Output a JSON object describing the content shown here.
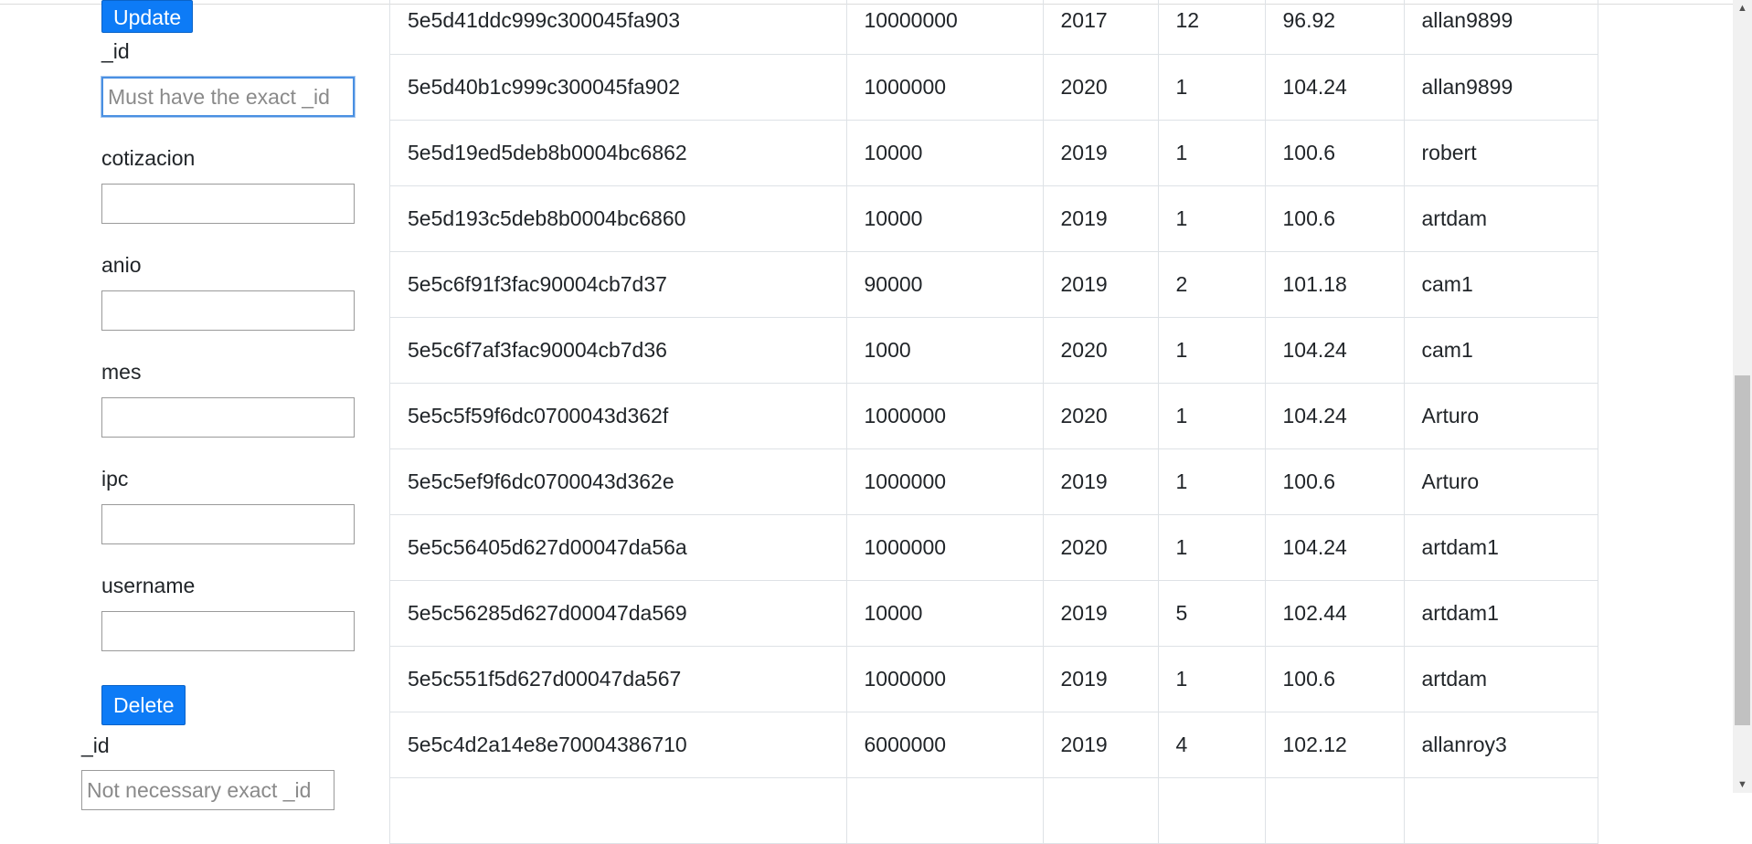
{
  "update_form": {
    "button_label": "Update",
    "fields": [
      {
        "label": "_id",
        "placeholder": "Must have the exact _id",
        "value": ""
      },
      {
        "label": "cotizacion",
        "placeholder": "",
        "value": ""
      },
      {
        "label": "anio",
        "placeholder": "",
        "value": ""
      },
      {
        "label": "mes",
        "placeholder": "",
        "value": ""
      },
      {
        "label": "ipc",
        "placeholder": "",
        "value": ""
      },
      {
        "label": "username",
        "placeholder": "",
        "value": ""
      }
    ]
  },
  "delete_form": {
    "button_label": "Delete",
    "fields": [
      {
        "label": "_id",
        "placeholder": "Not necessary exact _id",
        "value": ""
      }
    ]
  },
  "table": {
    "rows": [
      [
        "5e5d41ddc999c300045fa903",
        "10000000",
        "2017",
        "12",
        "96.92",
        "allan9899"
      ],
      [
        "5e5d40b1c999c300045fa902",
        "1000000",
        "2020",
        "1",
        "104.24",
        "allan9899"
      ],
      [
        "5e5d19ed5deb8b0004bc6862",
        "10000",
        "2019",
        "1",
        "100.6",
        "robert"
      ],
      [
        "5e5d193c5deb8b0004bc6860",
        "10000",
        "2019",
        "1",
        "100.6",
        "artdam"
      ],
      [
        "5e5c6f91f3fac90004cb7d37",
        "90000",
        "2019",
        "2",
        "101.18",
        "cam1"
      ],
      [
        "5e5c6f7af3fac90004cb7d36",
        "1000",
        "2020",
        "1",
        "104.24",
        "cam1"
      ],
      [
        "5e5c5f59f6dc0700043d362f",
        "1000000",
        "2020",
        "1",
        "104.24",
        "Arturo"
      ],
      [
        "5e5c5ef9f6dc0700043d362e",
        "1000000",
        "2019",
        "1",
        "100.6",
        "Arturo"
      ],
      [
        "5e5c56405d627d00047da56a",
        "1000000",
        "2020",
        "1",
        "104.24",
        "artdam1"
      ],
      [
        "5e5c56285d627d00047da569",
        "10000",
        "2019",
        "5",
        "102.44",
        "artdam1"
      ],
      [
        "5e5c551f5d627d00047da567",
        "1000000",
        "2019",
        "1",
        "100.6",
        "artdam"
      ],
      [
        "5e5c4d2a14e8e70004386710",
        "6000000",
        "2019",
        "4",
        "102.12",
        "allanroy3"
      ],
      [
        "",
        "",
        "",
        "",
        "",
        ""
      ]
    ]
  },
  "scrollbar": {
    "up_arrow": "▲",
    "down_arrow": "▼"
  }
}
